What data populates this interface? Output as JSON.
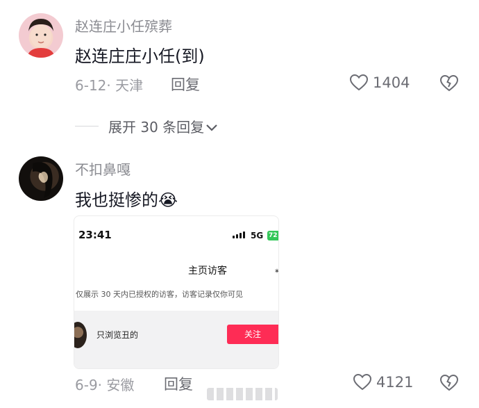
{
  "comments": [
    {
      "username": "赵连庄小任殡葬",
      "content": "赵连庄庄小任(到)",
      "date_location": "6-12· 天津",
      "reply_label": "回复",
      "like_count": "1404"
    },
    {
      "username": "不扣鼻嘎",
      "content": "我也挺惨的",
      "emoji": "😭",
      "date_location": "6-9· 安徽",
      "reply_label": "回复",
      "like_count": "4121"
    }
  ],
  "expand_replies_label": "展开 30 条回复",
  "embedded_screenshot": {
    "time": "23:41",
    "network": "5G",
    "battery": "72",
    "title": "主页访客",
    "description": "仅展示 30 天内已授权的访客，访客记录仅你可见",
    "visitor_name": "只浏览丑的",
    "follow_label": "关注"
  },
  "colors": {
    "follow_button": "#fe2c55",
    "battery": "#34c759"
  }
}
